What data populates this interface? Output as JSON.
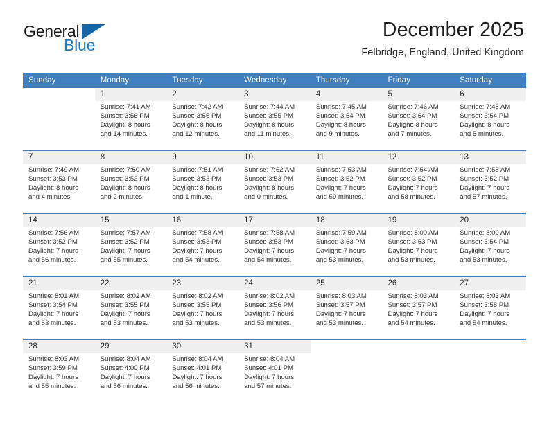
{
  "logo": {
    "text_primary": "General",
    "text_secondary": "Blue",
    "primary_color": "#1a1a1a",
    "secondary_color": "#1f78c1",
    "triangle_color": "#1565a8"
  },
  "header": {
    "title": "December 2025",
    "subtitle": "Felbridge, England, United Kingdom"
  },
  "theme": {
    "header_row_bg": "#3d7fbf",
    "header_row_text": "#ffffff",
    "daynum_bg": "#f0f0f0",
    "cell_bg": "#ffffff",
    "border_color": "#3d7fbf"
  },
  "weekday_headers": [
    "Sunday",
    "Monday",
    "Tuesday",
    "Wednesday",
    "Thursday",
    "Friday",
    "Saturday"
  ],
  "weeks": [
    [
      {
        "day": "",
        "lines": []
      },
      {
        "day": "1",
        "lines": [
          "Sunrise: 7:41 AM",
          "Sunset: 3:56 PM",
          "Daylight: 8 hours",
          "and 14 minutes."
        ]
      },
      {
        "day": "2",
        "lines": [
          "Sunrise: 7:42 AM",
          "Sunset: 3:55 PM",
          "Daylight: 8 hours",
          "and 12 minutes."
        ]
      },
      {
        "day": "3",
        "lines": [
          "Sunrise: 7:44 AM",
          "Sunset: 3:55 PM",
          "Daylight: 8 hours",
          "and 11 minutes."
        ]
      },
      {
        "day": "4",
        "lines": [
          "Sunrise: 7:45 AM",
          "Sunset: 3:54 PM",
          "Daylight: 8 hours",
          "and 9 minutes."
        ]
      },
      {
        "day": "5",
        "lines": [
          "Sunrise: 7:46 AM",
          "Sunset: 3:54 PM",
          "Daylight: 8 hours",
          "and 7 minutes."
        ]
      },
      {
        "day": "6",
        "lines": [
          "Sunrise: 7:48 AM",
          "Sunset: 3:54 PM",
          "Daylight: 8 hours",
          "and 5 minutes."
        ]
      }
    ],
    [
      {
        "day": "7",
        "lines": [
          "Sunrise: 7:49 AM",
          "Sunset: 3:53 PM",
          "Daylight: 8 hours",
          "and 4 minutes."
        ]
      },
      {
        "day": "8",
        "lines": [
          "Sunrise: 7:50 AM",
          "Sunset: 3:53 PM",
          "Daylight: 8 hours",
          "and 2 minutes."
        ]
      },
      {
        "day": "9",
        "lines": [
          "Sunrise: 7:51 AM",
          "Sunset: 3:53 PM",
          "Daylight: 8 hours",
          "and 1 minute."
        ]
      },
      {
        "day": "10",
        "lines": [
          "Sunrise: 7:52 AM",
          "Sunset: 3:53 PM",
          "Daylight: 8 hours",
          "and 0 minutes."
        ]
      },
      {
        "day": "11",
        "lines": [
          "Sunrise: 7:53 AM",
          "Sunset: 3:52 PM",
          "Daylight: 7 hours",
          "and 59 minutes."
        ]
      },
      {
        "day": "12",
        "lines": [
          "Sunrise: 7:54 AM",
          "Sunset: 3:52 PM",
          "Daylight: 7 hours",
          "and 58 minutes."
        ]
      },
      {
        "day": "13",
        "lines": [
          "Sunrise: 7:55 AM",
          "Sunset: 3:52 PM",
          "Daylight: 7 hours",
          "and 57 minutes."
        ]
      }
    ],
    [
      {
        "day": "14",
        "lines": [
          "Sunrise: 7:56 AM",
          "Sunset: 3:52 PM",
          "Daylight: 7 hours",
          "and 56 minutes."
        ]
      },
      {
        "day": "15",
        "lines": [
          "Sunrise: 7:57 AM",
          "Sunset: 3:52 PM",
          "Daylight: 7 hours",
          "and 55 minutes."
        ]
      },
      {
        "day": "16",
        "lines": [
          "Sunrise: 7:58 AM",
          "Sunset: 3:53 PM",
          "Daylight: 7 hours",
          "and 54 minutes."
        ]
      },
      {
        "day": "17",
        "lines": [
          "Sunrise: 7:58 AM",
          "Sunset: 3:53 PM",
          "Daylight: 7 hours",
          "and 54 minutes."
        ]
      },
      {
        "day": "18",
        "lines": [
          "Sunrise: 7:59 AM",
          "Sunset: 3:53 PM",
          "Daylight: 7 hours",
          "and 53 minutes."
        ]
      },
      {
        "day": "19",
        "lines": [
          "Sunrise: 8:00 AM",
          "Sunset: 3:53 PM",
          "Daylight: 7 hours",
          "and 53 minutes."
        ]
      },
      {
        "day": "20",
        "lines": [
          "Sunrise: 8:00 AM",
          "Sunset: 3:54 PM",
          "Daylight: 7 hours",
          "and 53 minutes."
        ]
      }
    ],
    [
      {
        "day": "21",
        "lines": [
          "Sunrise: 8:01 AM",
          "Sunset: 3:54 PM",
          "Daylight: 7 hours",
          "and 53 minutes."
        ]
      },
      {
        "day": "22",
        "lines": [
          "Sunrise: 8:02 AM",
          "Sunset: 3:55 PM",
          "Daylight: 7 hours",
          "and 53 minutes."
        ]
      },
      {
        "day": "23",
        "lines": [
          "Sunrise: 8:02 AM",
          "Sunset: 3:55 PM",
          "Daylight: 7 hours",
          "and 53 minutes."
        ]
      },
      {
        "day": "24",
        "lines": [
          "Sunrise: 8:02 AM",
          "Sunset: 3:56 PM",
          "Daylight: 7 hours",
          "and 53 minutes."
        ]
      },
      {
        "day": "25",
        "lines": [
          "Sunrise: 8:03 AM",
          "Sunset: 3:57 PM",
          "Daylight: 7 hours",
          "and 53 minutes."
        ]
      },
      {
        "day": "26",
        "lines": [
          "Sunrise: 8:03 AM",
          "Sunset: 3:57 PM",
          "Daylight: 7 hours",
          "and 54 minutes."
        ]
      },
      {
        "day": "27",
        "lines": [
          "Sunrise: 8:03 AM",
          "Sunset: 3:58 PM",
          "Daylight: 7 hours",
          "and 54 minutes."
        ]
      }
    ],
    [
      {
        "day": "28",
        "lines": [
          "Sunrise: 8:03 AM",
          "Sunset: 3:59 PM",
          "Daylight: 7 hours",
          "and 55 minutes."
        ]
      },
      {
        "day": "29",
        "lines": [
          "Sunrise: 8:04 AM",
          "Sunset: 4:00 PM",
          "Daylight: 7 hours",
          "and 56 minutes."
        ]
      },
      {
        "day": "30",
        "lines": [
          "Sunrise: 8:04 AM",
          "Sunset: 4:01 PM",
          "Daylight: 7 hours",
          "and 56 minutes."
        ]
      },
      {
        "day": "31",
        "lines": [
          "Sunrise: 8:04 AM",
          "Sunset: 4:01 PM",
          "Daylight: 7 hours",
          "and 57 minutes."
        ]
      },
      {
        "day": "",
        "lines": []
      },
      {
        "day": "",
        "lines": []
      },
      {
        "day": "",
        "lines": []
      }
    ]
  ]
}
